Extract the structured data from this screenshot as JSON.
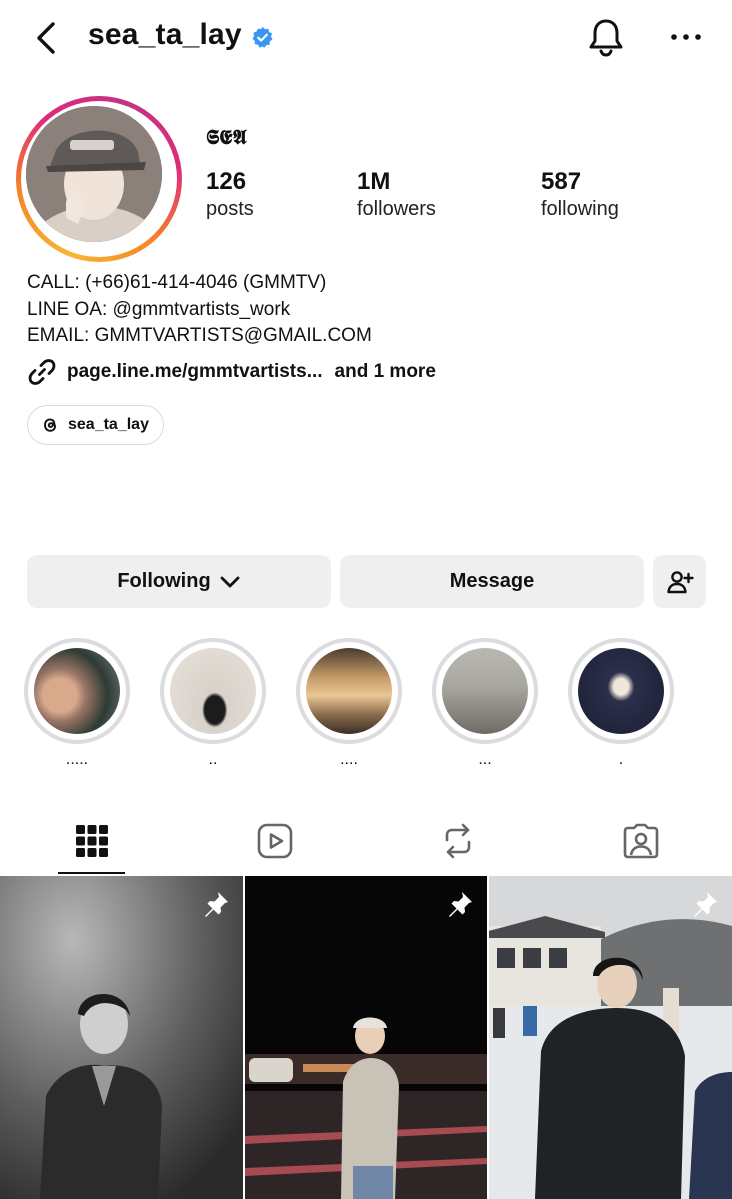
{
  "profile": {
    "username": "sea_ta_lay",
    "display_name": "𝕾𝕰𝕬",
    "verified": true,
    "stats": [
      {
        "value": "126",
        "label": "posts"
      },
      {
        "value": "1M",
        "label": "followers"
      },
      {
        "value": "587",
        "label": "following"
      }
    ],
    "bio": [
      "CALL: (+66)61-414-4046 (GMMTV)",
      "LINE OA: @gmmtvartists_work",
      "EMAIL: GMMTVARTISTS@GMAIL.COM"
    ],
    "link": {
      "text": "page.line.me/gmmtvartists...",
      "more": "and 1 more"
    },
    "threads_handle": "sea_ta_lay"
  },
  "actions": {
    "following_label": "Following",
    "message_label": "Message"
  },
  "highlights": [
    {
      "caption": "....."
    },
    {
      "caption": ".."
    },
    {
      "caption": "...."
    },
    {
      "caption": "..."
    },
    {
      "caption": "."
    }
  ],
  "tabs": [
    "grid",
    "reels",
    "reposts",
    "tagged"
  ],
  "colors": {
    "verified": "#3897f0",
    "button_bg": "#efefef",
    "highlight_ring": "#dcdcdf"
  }
}
